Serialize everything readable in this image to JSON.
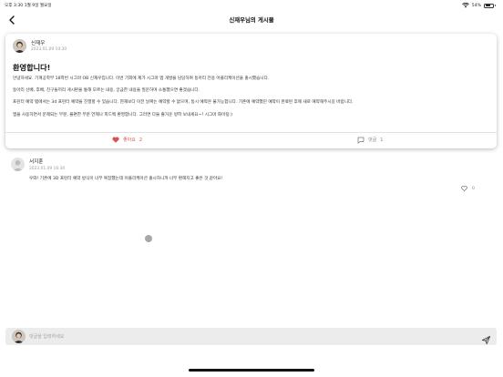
{
  "status_bar": {
    "time_date": "오후 3:30   1월 9일 월요일",
    "battery_text": "54%",
    "battery_level": 0.54
  },
  "header": {
    "title": "신재우님의 게시물",
    "back_icon": "chevron-left-icon"
  },
  "post": {
    "author": "신재우",
    "date": "2023.01.09 10:30",
    "title": "환영합니다!",
    "body_lines": [
      "안녕하세요. 기계공학부 18학번 시그마 OB 신재우입니다. 이번 기회에 제가 시그마 앱 개발을 담당하여 동아리 전용 어플리케이션을 출시했습니다.",
      "동아리 선배, 후배, 친구들끼리 게시판을 통해 모르는 내용, 궁금한 내용을 질문하며 소통했으면 좋겠습니다.",
      "프린터 예약 탭에서는 3d 프린터 예약을 진행할 수 있습니다. 현재보다 이전 날짜는 예약할 수 없으며, 동시 예약은 불가능합니다. 기존에 예약했던 예약이 완료된 후에 새로 예약해주시길 바랍니다.",
      "앱을 사용하면서 문제되는 부분, 불편한 부분 언제나 피드백 환영합니다. 그러면 다들 즐거운 방학 보내세요~! 시그마 화이팅:)"
    ],
    "like_label": "좋아요",
    "like_count": "2",
    "comment_label": "댓글",
    "comment_count": "1",
    "like_icon": "heart-filled-icon",
    "comment_icon": "speech-bubble-icon"
  },
  "comments": [
    {
      "author": "서지훈",
      "date": "2023.01.09 16:30",
      "text": "우와! 기존에 3D 프린터 예약 방식이 너무 복잡했는데 어플리케이션 출시하니까 너무 편해지고 좋은 것 같아요!",
      "like_count": "0",
      "like_icon": "heart-outline-icon"
    }
  ],
  "comment_input": {
    "placeholder": "댓글을 입력하세요",
    "send_icon": "send-icon"
  },
  "colors": {
    "like_red": "#d9534f",
    "muted_gray": "#888888",
    "input_bg": "#ececec"
  }
}
